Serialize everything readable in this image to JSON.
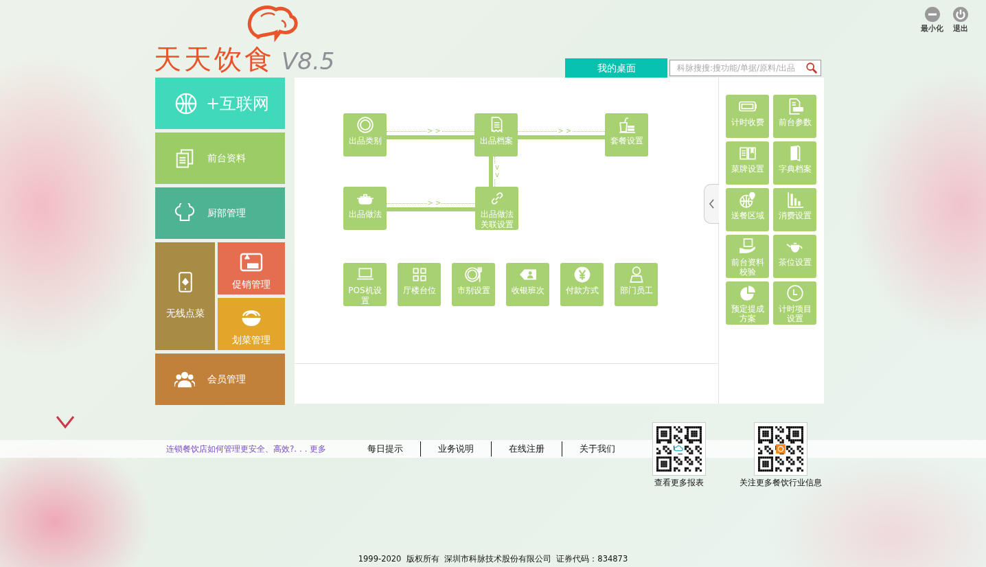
{
  "window_controls": [
    {
      "label": "最小化",
      "kind": "minimize"
    },
    {
      "label": "退出",
      "kind": "exit"
    }
  ],
  "logo": {
    "title": "天天饮食",
    "version": "V8.5"
  },
  "tabs": [
    {
      "label": "我的桌面",
      "selected": true
    }
  ],
  "search": {
    "placeholder": "科脉搜搜:搜功能/单据/原料/出品"
  },
  "left_menu": [
    {
      "kind": "banner",
      "label": "+互联网",
      "color": "#40d9bb"
    },
    {
      "kind": "tile",
      "label": "前台资料",
      "color": "#9ccc65"
    },
    {
      "kind": "tile",
      "label": "厨部管理",
      "color": "#4db392"
    },
    {
      "kind": "tall",
      "label": "无线点菜",
      "color": "#a88c45"
    },
    {
      "kind": "half",
      "label": "促销管理",
      "color": "#e56d50"
    },
    {
      "kind": "half",
      "label": "划菜管理",
      "color": "#e2a62a"
    },
    {
      "kind": "tile",
      "label": "会员管理",
      "color": "#c1813a"
    }
  ],
  "flow_nodes": [
    {
      "label": "出品类别"
    },
    {
      "label": "出品档案"
    },
    {
      "label": "套餐设置"
    },
    {
      "label": "出品做法"
    },
    {
      "label": "出品做法关联设置"
    }
  ],
  "connectors": [
    {
      "label": "> >"
    },
    {
      "label": "> >"
    },
    {
      "label": "vv"
    },
    {
      "label": "> >"
    }
  ],
  "setup_tiles": [
    {
      "label": "POS机设置"
    },
    {
      "label": "厅楼台位"
    },
    {
      "label": "市别设置"
    },
    {
      "label": "收银班次"
    },
    {
      "label": "付款方式"
    },
    {
      "label": "部门员工"
    }
  ],
  "shortcut_tiles": [
    {
      "label": "计时收费"
    },
    {
      "label": "前台参数"
    },
    {
      "label": "菜牌设置"
    },
    {
      "label": "字典档案"
    },
    {
      "label": "送餐区域"
    },
    {
      "label": "消费设置"
    },
    {
      "label": "前台资料校验"
    },
    {
      "label": "茶位设置"
    },
    {
      "label": "预定提成方案"
    },
    {
      "label": "计时项目设置"
    }
  ],
  "news": {
    "text": "连锁餐饮店如何管理更安全、高效?. . .",
    "more": "更多"
  },
  "bottom_links": [
    "每日提示",
    "业务说明",
    "在线注册",
    "关于我们"
  ],
  "qr_codes": [
    {
      "caption": "查看更多报表",
      "kind": "cloud"
    },
    {
      "caption": "关注更多餐饮行业信息",
      "kind": "brand"
    }
  ],
  "footer": "1999-2020  版权所有  深圳市科脉技术股份有限公司  证券代码：834873"
}
